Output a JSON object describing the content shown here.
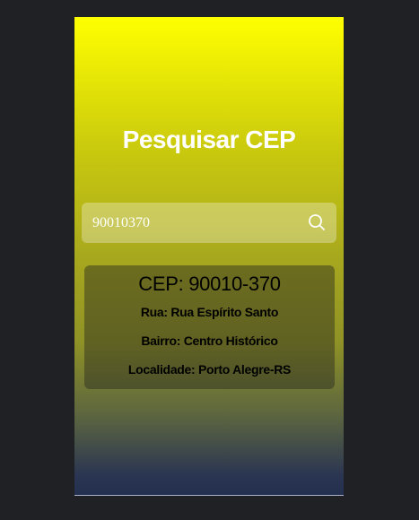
{
  "app": {
    "title": "Pesquisar CEP"
  },
  "search": {
    "value": "90010370",
    "icon": "search-icon"
  },
  "result": {
    "cep_line": "CEP: 90010-370",
    "rua_line": "Rua: Rua Espírito Santo",
    "bairro_line": "Bairro: Centro Histórico",
    "localidade_line": "Localidade: Porto Alegre-RS"
  },
  "colors": {
    "page_background": "#202124",
    "gradient_top": "#ffff00",
    "gradient_bottom": "#24304f",
    "title_text": "#ffffff",
    "result_text": "#000000"
  }
}
